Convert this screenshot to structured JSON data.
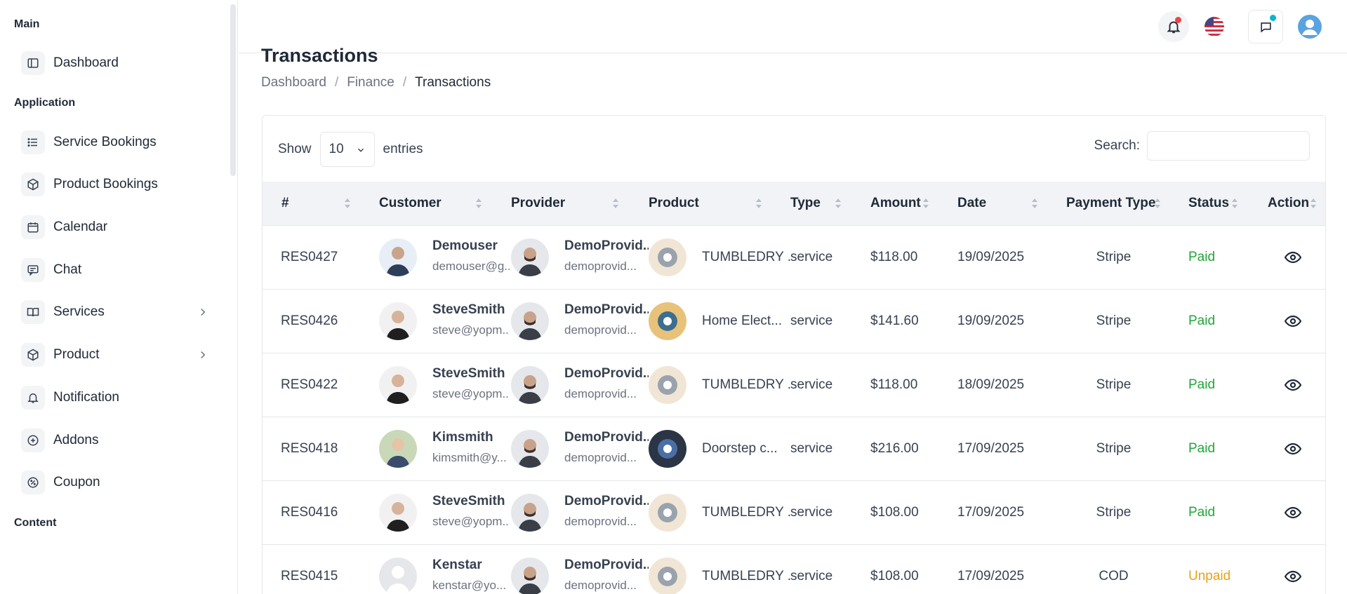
{
  "sidebar": {
    "section_main": "Main",
    "section_application": "Application",
    "section_content": "Content",
    "items": [
      {
        "label": "Dashboard",
        "icon": "layout-icon"
      },
      {
        "label": "Service Bookings",
        "icon": "list-icon"
      },
      {
        "label": "Product Bookings",
        "icon": "box-icon"
      },
      {
        "label": "Calendar",
        "icon": "calendar-icon"
      },
      {
        "label": "Chat",
        "icon": "chat-icon"
      },
      {
        "label": "Services",
        "icon": "book-icon"
      },
      {
        "label": "Product",
        "icon": "box-icon"
      },
      {
        "label": "Notification",
        "icon": "bell-icon"
      },
      {
        "label": "Addons",
        "icon": "plus-circle-icon"
      },
      {
        "label": "Coupon",
        "icon": "percent-icon"
      }
    ]
  },
  "header": {
    "icons": [
      "bell-icon",
      "us-flag-icon",
      "chat-bubble-icon",
      "user-avatar"
    ],
    "notif_dot_color": "#ef4444",
    "chat_dot_color": "#06b6d4"
  },
  "page": {
    "title": "Transactions",
    "breadcrumb": [
      "Dashboard",
      "Finance",
      "Transactions"
    ]
  },
  "table_controls": {
    "show_label": "Show",
    "entries_value": "10",
    "entries_label": "entries",
    "search_label": "Search:",
    "search_value": ""
  },
  "columns": [
    "#",
    "Customer",
    "Provider",
    "Product",
    "Type",
    "Amount",
    "Date",
    "Payment Type",
    "Status",
    "Action"
  ],
  "rows": [
    {
      "id": "RES0427",
      "customer": "Demouser",
      "customer_email": "demouser@g...",
      "provider": "DemoProvid...",
      "provider_email": "demoprovid...",
      "product": "TUMBLEDRY ...",
      "type": "service",
      "amount": "$118.00",
      "date": "19/09/2025",
      "payment": "Stripe",
      "status": "Paid"
    },
    {
      "id": "RES0426",
      "customer": "SteveSmith",
      "customer_email": "steve@yopm...",
      "provider": "DemoProvid...",
      "provider_email": "demoprovid...",
      "product": "Home Elect...",
      "type": "service",
      "amount": "$141.60",
      "date": "19/09/2025",
      "payment": "Stripe",
      "status": "Paid"
    },
    {
      "id": "RES0422",
      "customer": "SteveSmith",
      "customer_email": "steve@yopm...",
      "provider": "DemoProvid...",
      "provider_email": "demoprovid...",
      "product": "TUMBLEDRY ...",
      "type": "service",
      "amount": "$118.00",
      "date": "18/09/2025",
      "payment": "Stripe",
      "status": "Paid"
    },
    {
      "id": "RES0418",
      "customer": "Kimsmith",
      "customer_email": "kimsmith@y...",
      "provider": "DemoProvid...",
      "provider_email": "demoprovid...",
      "product": "Doorstep c...",
      "type": "service",
      "amount": "$216.00",
      "date": "17/09/2025",
      "payment": "Stripe",
      "status": "Paid"
    },
    {
      "id": "RES0416",
      "customer": "SteveSmith",
      "customer_email": "steve@yopm...",
      "provider": "DemoProvid...",
      "provider_email": "demoprovid...",
      "product": "TUMBLEDRY ...",
      "type": "service",
      "amount": "$108.00",
      "date": "17/09/2025",
      "payment": "Stripe",
      "status": "Paid"
    },
    {
      "id": "RES0415",
      "customer": "Kenstar",
      "customer_email": "kenstar@yo...",
      "provider": "DemoProvid...",
      "provider_email": "demoprovid...",
      "product": "TUMBLEDRY ...",
      "type": "service",
      "amount": "$108.00",
      "date": "17/09/2025",
      "payment": "COD",
      "status": "Unpaid"
    }
  ]
}
